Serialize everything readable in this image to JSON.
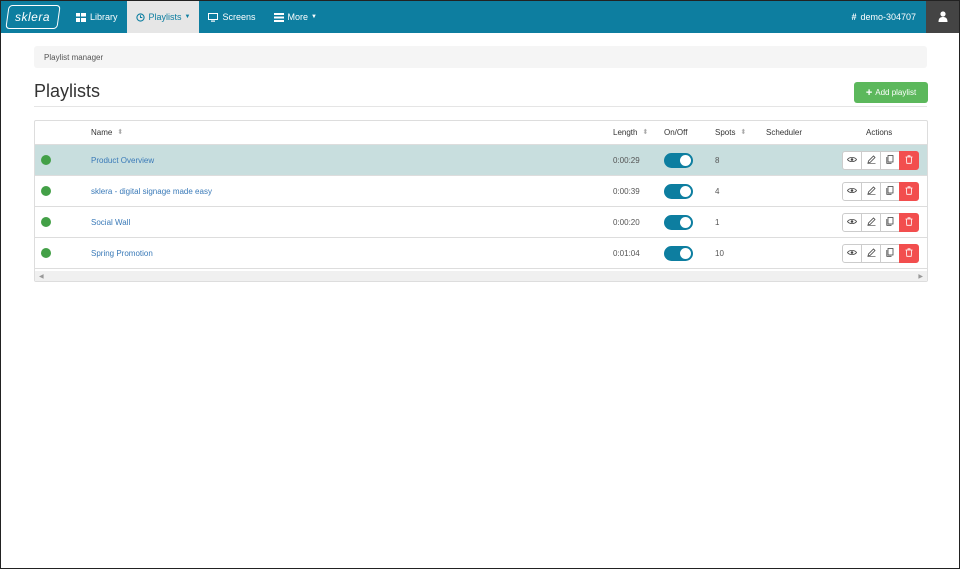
{
  "brand": {
    "logo_text": "sklera"
  },
  "nav": {
    "library": "Library",
    "playlists": "Playlists",
    "screens": "Screens",
    "more": "More",
    "workspace": "demo-304707"
  },
  "breadcrumb": "Playlist manager",
  "page": {
    "title": "Playlists",
    "add_button": "Add playlist"
  },
  "table": {
    "headers": {
      "name": "Name",
      "length": "Length",
      "onoff": "On/Off",
      "spots": "Spots",
      "scheduler": "Scheduler",
      "actions": "Actions"
    },
    "rows": [
      {
        "name": "Product Overview",
        "length": "0:00:29",
        "on": true,
        "spots": "8"
      },
      {
        "name": "sklera - digital signage made easy",
        "length": "0:00:39",
        "on": true,
        "spots": "4"
      },
      {
        "name": "Social Wall",
        "length": "0:00:20",
        "on": true,
        "spots": "1"
      },
      {
        "name": "Spring Promotion",
        "length": "0:01:04",
        "on": true,
        "spots": "10"
      }
    ]
  },
  "colors": {
    "navbar": "#0d7ea0",
    "status_active": "#43a047",
    "add_button": "#5cb85c",
    "delete": "#f24e4e",
    "selected_row": "#c8dede"
  }
}
